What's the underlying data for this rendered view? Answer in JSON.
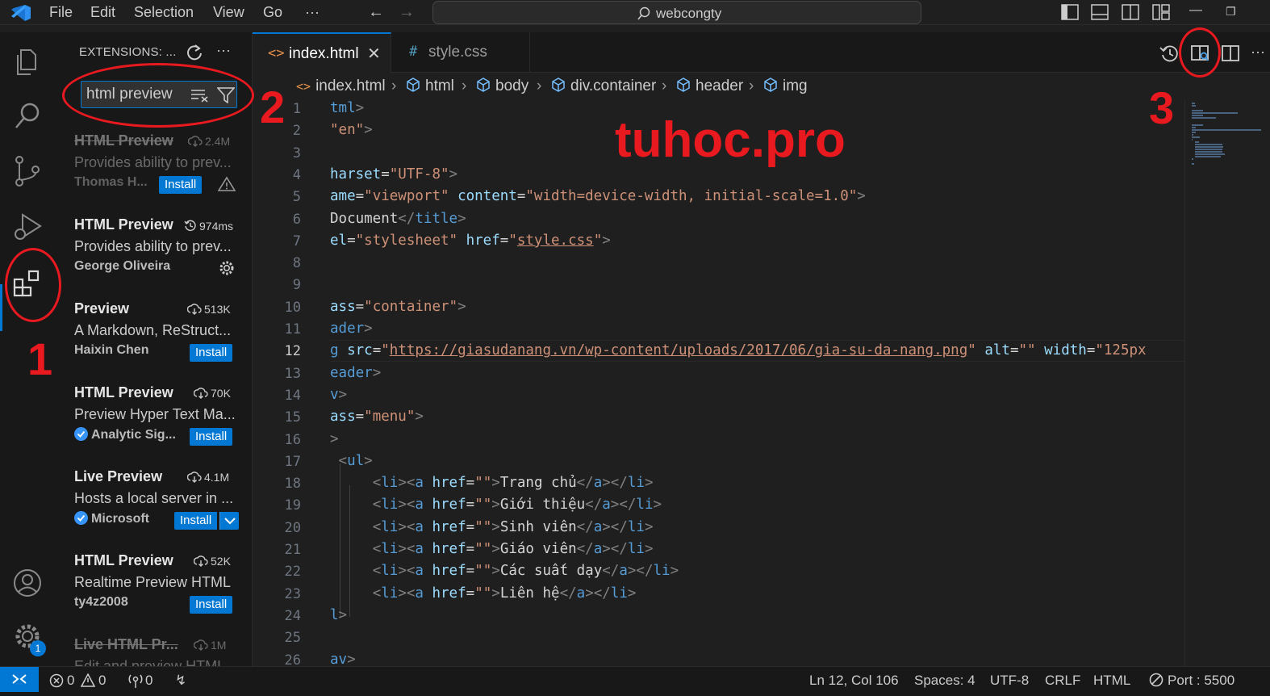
{
  "titlebar": {
    "menu": [
      "File",
      "Edit",
      "Selection",
      "View",
      "Go",
      "···"
    ],
    "search_label": "webcongty"
  },
  "sidebar": {
    "title": "EXTENSIONS: ...",
    "search_value": "html preview",
    "extensions": [
      {
        "name": "HTML Preview",
        "stat": "2.4M",
        "desc": "Provides ability to prev...",
        "publisher": "Thomas H...",
        "action": "Install",
        "disabled": true,
        "warning": true
      },
      {
        "name": "HTML Preview",
        "stat": "974ms",
        "desc": "Provides ability to prev...",
        "publisher": "George Oliveira",
        "action": "",
        "installed": true
      },
      {
        "name": "Preview",
        "stat": "513K",
        "desc": "A Markdown, ReStruct...",
        "publisher": "Haixin Chen",
        "action": "Install"
      },
      {
        "name": "HTML Preview",
        "stat": "70K",
        "desc": "Preview Hyper Text Ma...",
        "publisher": "Analytic Sig...",
        "action": "Install",
        "verified": true
      },
      {
        "name": "Live Preview",
        "stat": "4.1M",
        "desc": "Hosts a local server in ...",
        "publisher": "Microsoft",
        "action": "Install",
        "verified": true,
        "split": true
      },
      {
        "name": "HTML Preview",
        "stat": "52K",
        "desc": "Realtime Preview HTML",
        "publisher": "ty4z2008",
        "action": "Install"
      },
      {
        "name": "Live HTML Pr...",
        "stat": "1M",
        "desc": "Edit and preview HTML...",
        "publisher": "",
        "action": "",
        "disabled": true
      }
    ]
  },
  "tabs": [
    {
      "icon": "<>",
      "label": "index.html",
      "active": true
    },
    {
      "icon": "#",
      "label": "style.css",
      "active": false
    }
  ],
  "breadcrumb": [
    "index.html",
    "html",
    "body",
    "div.container",
    "header",
    "img"
  ],
  "editor": {
    "active_line": 12,
    "lines": [
      {
        "n": 1,
        "tokens": [
          [
            "tag",
            "tml"
          ],
          [
            "punct",
            ">"
          ]
        ]
      },
      {
        "n": 2,
        "tokens": [
          [
            "str",
            "\"en\""
          ],
          [
            "punct",
            ">"
          ]
        ]
      },
      {
        "n": 3,
        "tokens": []
      },
      {
        "n": 4,
        "tokens": [
          [
            "attr",
            "harset"
          ],
          [
            "text",
            "="
          ],
          [
            "str",
            "\"UTF-8\""
          ],
          [
            "punct",
            ">"
          ]
        ]
      },
      {
        "n": 5,
        "tokens": [
          [
            "attr",
            "ame"
          ],
          [
            "text",
            "="
          ],
          [
            "str",
            "\"viewport\""
          ],
          [
            "text",
            " "
          ],
          [
            "attr",
            "content"
          ],
          [
            "text",
            "="
          ],
          [
            "str",
            "\"width=device-width, initial-scale=1.0\""
          ],
          [
            "punct",
            ">"
          ]
        ]
      },
      {
        "n": 6,
        "tokens": [
          [
            "text",
            "Document"
          ],
          [
            "punct",
            "</"
          ],
          [
            "tag",
            "title"
          ],
          [
            "punct",
            ">"
          ]
        ]
      },
      {
        "n": 7,
        "tokens": [
          [
            "attr",
            "el"
          ],
          [
            "text",
            "="
          ],
          [
            "str",
            "\"stylesheet\""
          ],
          [
            "text",
            " "
          ],
          [
            "attr",
            "href"
          ],
          [
            "text",
            "="
          ],
          [
            "str",
            "\""
          ],
          [
            "link",
            "style.css"
          ],
          [
            "str",
            "\""
          ],
          [
            "punct",
            ">"
          ]
        ]
      },
      {
        "n": 8,
        "tokens": []
      },
      {
        "n": 9,
        "tokens": []
      },
      {
        "n": 10,
        "tokens": [
          [
            "attr",
            "ass"
          ],
          [
            "text",
            "="
          ],
          [
            "str",
            "\"container\""
          ],
          [
            "punct",
            ">"
          ]
        ]
      },
      {
        "n": 11,
        "tokens": [
          [
            "tag",
            "ader"
          ],
          [
            "punct",
            ">"
          ]
        ]
      },
      {
        "n": 12,
        "tokens": [
          [
            "tag",
            "g"
          ],
          [
            "text",
            " "
          ],
          [
            "attr",
            "src"
          ],
          [
            "text",
            "="
          ],
          [
            "str",
            "\""
          ],
          [
            "link",
            "https://giasudanang.vn/wp-content/uploads/2017/06/gia-su-da-nang.png"
          ],
          [
            "str",
            "\""
          ],
          [
            "text",
            " "
          ],
          [
            "attr",
            "alt"
          ],
          [
            "text",
            "="
          ],
          [
            "str",
            "\"\""
          ],
          [
            "text",
            " "
          ],
          [
            "attr",
            "width"
          ],
          [
            "text",
            "="
          ],
          [
            "str",
            "\"125px"
          ]
        ]
      },
      {
        "n": 13,
        "tokens": [
          [
            "tag",
            "eader"
          ],
          [
            "punct",
            ">"
          ]
        ]
      },
      {
        "n": 14,
        "tokens": [
          [
            "tag",
            "v"
          ],
          [
            "punct",
            ">"
          ]
        ]
      },
      {
        "n": 15,
        "tokens": [
          [
            "attr",
            "ass"
          ],
          [
            "text",
            "="
          ],
          [
            "str",
            "\"menu\""
          ],
          [
            "punct",
            ">"
          ]
        ]
      },
      {
        "n": 16,
        "tokens": [
          [
            "punct",
            ">"
          ]
        ]
      },
      {
        "n": 17,
        "tokens": [
          [
            "text",
            " "
          ],
          [
            "punct",
            "<"
          ],
          [
            "tag",
            "ul"
          ],
          [
            "punct",
            ">"
          ]
        ]
      },
      {
        "n": 18,
        "tokens": [
          [
            "text",
            "     "
          ],
          [
            "punct",
            "<"
          ],
          [
            "tag",
            "li"
          ],
          [
            "punct",
            "><"
          ],
          [
            "tag",
            "a"
          ],
          [
            "text",
            " "
          ],
          [
            "attr",
            "href"
          ],
          [
            "text",
            "="
          ],
          [
            "str",
            "\"\""
          ],
          [
            "punct",
            ">"
          ],
          [
            "text",
            "Trang chủ"
          ],
          [
            "punct",
            "</"
          ],
          [
            "tag",
            "a"
          ],
          [
            "punct",
            "></"
          ],
          [
            "tag",
            "li"
          ],
          [
            "punct",
            ">"
          ]
        ]
      },
      {
        "n": 19,
        "tokens": [
          [
            "text",
            "     "
          ],
          [
            "punct",
            "<"
          ],
          [
            "tag",
            "li"
          ],
          [
            "punct",
            "><"
          ],
          [
            "tag",
            "a"
          ],
          [
            "text",
            " "
          ],
          [
            "attr",
            "href"
          ],
          [
            "text",
            "="
          ],
          [
            "str",
            "\"\""
          ],
          [
            "punct",
            ">"
          ],
          [
            "text",
            "Giới thiệu"
          ],
          [
            "punct",
            "</"
          ],
          [
            "tag",
            "a"
          ],
          [
            "punct",
            "></"
          ],
          [
            "tag",
            "li"
          ],
          [
            "punct",
            ">"
          ]
        ]
      },
      {
        "n": 20,
        "tokens": [
          [
            "text",
            "     "
          ],
          [
            "punct",
            "<"
          ],
          [
            "tag",
            "li"
          ],
          [
            "punct",
            "><"
          ],
          [
            "tag",
            "a"
          ],
          [
            "text",
            " "
          ],
          [
            "attr",
            "href"
          ],
          [
            "text",
            "="
          ],
          [
            "str",
            "\"\""
          ],
          [
            "punct",
            ">"
          ],
          [
            "text",
            "Sinh viên"
          ],
          [
            "punct",
            "</"
          ],
          [
            "tag",
            "a"
          ],
          [
            "punct",
            "></"
          ],
          [
            "tag",
            "li"
          ],
          [
            "punct",
            ">"
          ]
        ]
      },
      {
        "n": 21,
        "tokens": [
          [
            "text",
            "     "
          ],
          [
            "punct",
            "<"
          ],
          [
            "tag",
            "li"
          ],
          [
            "punct",
            "><"
          ],
          [
            "tag",
            "a"
          ],
          [
            "text",
            " "
          ],
          [
            "attr",
            "href"
          ],
          [
            "text",
            "="
          ],
          [
            "str",
            "\"\""
          ],
          [
            "punct",
            ">"
          ],
          [
            "text",
            "Giáo viên"
          ],
          [
            "punct",
            "</"
          ],
          [
            "tag",
            "a"
          ],
          [
            "punct",
            "></"
          ],
          [
            "tag",
            "li"
          ],
          [
            "punct",
            ">"
          ]
        ]
      },
      {
        "n": 22,
        "tokens": [
          [
            "text",
            "     "
          ],
          [
            "punct",
            "<"
          ],
          [
            "tag",
            "li"
          ],
          [
            "punct",
            "><"
          ],
          [
            "tag",
            "a"
          ],
          [
            "text",
            " "
          ],
          [
            "attr",
            "href"
          ],
          [
            "text",
            "="
          ],
          [
            "str",
            "\"\""
          ],
          [
            "punct",
            ">"
          ],
          [
            "text",
            "Các suất dạy"
          ],
          [
            "punct",
            "</"
          ],
          [
            "tag",
            "a"
          ],
          [
            "punct",
            "></"
          ],
          [
            "tag",
            "li"
          ],
          [
            "punct",
            ">"
          ]
        ]
      },
      {
        "n": 23,
        "tokens": [
          [
            "text",
            "     "
          ],
          [
            "punct",
            "<"
          ],
          [
            "tag",
            "li"
          ],
          [
            "punct",
            "><"
          ],
          [
            "tag",
            "a"
          ],
          [
            "text",
            " "
          ],
          [
            "attr",
            "href"
          ],
          [
            "text",
            "="
          ],
          [
            "str",
            "\"\""
          ],
          [
            "punct",
            ">"
          ],
          [
            "text",
            "Liên hệ"
          ],
          [
            "punct",
            "</"
          ],
          [
            "tag",
            "a"
          ],
          [
            "punct",
            "></"
          ],
          [
            "tag",
            "li"
          ],
          [
            "punct",
            ">"
          ]
        ]
      },
      {
        "n": 24,
        "tokens": [
          [
            "tag",
            "l"
          ],
          [
            "punct",
            ">"
          ]
        ]
      },
      {
        "n": 25,
        "tokens": []
      },
      {
        "n": 26,
        "tokens": [
          [
            "tag",
            "av"
          ],
          [
            "punct",
            ">"
          ]
        ]
      }
    ]
  },
  "watermark": "tuhoc.pro",
  "annotations": [
    "1",
    "2",
    "3"
  ],
  "statusbar": {
    "errors": "0",
    "warnings": "0",
    "ports": "0",
    "position": "Ln 12, Col 106",
    "spaces": "Spaces: 4",
    "encoding": "UTF-8",
    "eol": "CRLF",
    "language": "HTML",
    "port": "Port : 5500"
  },
  "colors": {
    "accent": "#0078d4",
    "annotation": "#e8191f",
    "tag": "#569cd6",
    "attr": "#9cdcfe",
    "string": "#ce9178"
  },
  "icons": [
    "vscode-logo-icon",
    "explorer-icon",
    "search-icon",
    "source-control-icon",
    "run-debug-icon",
    "extensions-icon",
    "account-icon",
    "settings-gear-icon",
    "refresh-icon",
    "filter-icon",
    "clear-filter-icon",
    "download-icon",
    "history-icon",
    "settings-icon",
    "warning-icon",
    "verified-icon",
    "timeline-icon",
    "open-preview-icon",
    "split-editor-icon",
    "remote-icon",
    "error-icon",
    "broadcast-icon",
    "lightning-icon",
    "no-port-icon"
  ]
}
